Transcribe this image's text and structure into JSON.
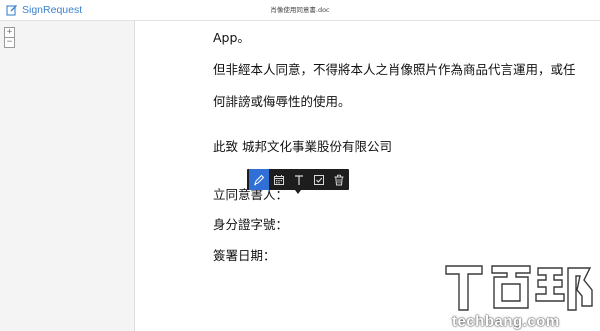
{
  "header": {
    "brand": "SignRequest",
    "document_title": "肖像使用同意書.doc"
  },
  "sidebar": {
    "zoom_in": "+",
    "zoom_out": "−"
  },
  "document": {
    "lines": [
      "App。",
      "但非經本人同意，不得將本人之肖像照片作為商品代言運用，或任",
      "何誹謗或侮辱性的使用。",
      "此致  城邦文化事業股份有限公司",
      "立同意書人：",
      "身分證字號：",
      "簽署日期："
    ]
  },
  "toolbar": {
    "tools": [
      "pen-icon",
      "calendar-icon",
      "text-icon",
      "checkbox-icon",
      "trash-icon"
    ],
    "active_tool": "pen-icon",
    "active_color": "#2f6fd6"
  },
  "watermark": {
    "site": "techbang.com"
  }
}
